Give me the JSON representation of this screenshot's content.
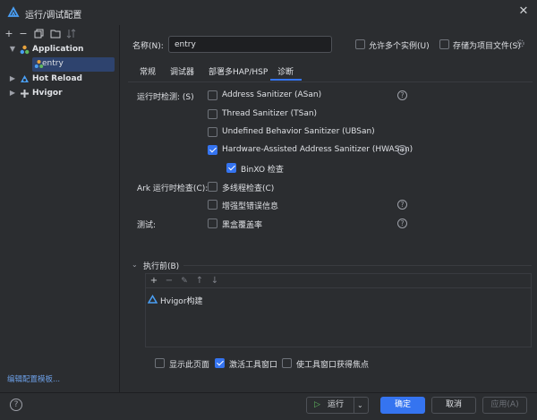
{
  "window": {
    "title": "运行/调试配置"
  },
  "sidebar": {
    "tree": [
      {
        "label": "Application",
        "bold": true,
        "expanded": true
      },
      {
        "label": "entry",
        "selected": true
      },
      {
        "label": "Hot Reload",
        "bold": true,
        "expanded": false
      },
      {
        "label": "Hvigor",
        "bold": true,
        "expanded": false
      }
    ],
    "edit_templates_link": "编辑配置模板..."
  },
  "header": {
    "name_label": "名称(N):",
    "name_value": "entry",
    "allow_multiple_label": "允许多个实例(U)",
    "store_as_project_label": "存储为项目文件(S)"
  },
  "tabs": [
    {
      "label": "常规"
    },
    {
      "label": "调试器"
    },
    {
      "label": "部署多HAP/HSP"
    },
    {
      "label": "诊断",
      "active": true
    }
  ],
  "diagnostics": {
    "runtime_label": "运行时检测: (S)",
    "asan": "Address Sanitizer (ASan)",
    "tsan": "Thread Sanitizer (TSan)",
    "ubsan": "Undefined Behavior Sanitizer (UBSan)",
    "hwasan": "Hardware-Assisted Address Sanitizer (HWASan)",
    "binxo": "BinXO 检查",
    "ark_label": "Ark 运行时检查(C):",
    "multithread": "多线程检查(C)",
    "enhanced_error": "增强型错误信息",
    "test_label": "测试:",
    "blackbox": "黑盒覆盖率"
  },
  "before_launch": {
    "label": "执行前(B)",
    "tasks": [
      {
        "label": "Hvigor构建"
      }
    ]
  },
  "options": {
    "show_page": "显示此页面",
    "activate_tool_window": "激活工具窗口",
    "focus_tool_window": "使工具窗口获得焦点"
  },
  "footer": {
    "run": "运行",
    "ok": "确定",
    "cancel": "取消",
    "apply": "应用(A)"
  }
}
